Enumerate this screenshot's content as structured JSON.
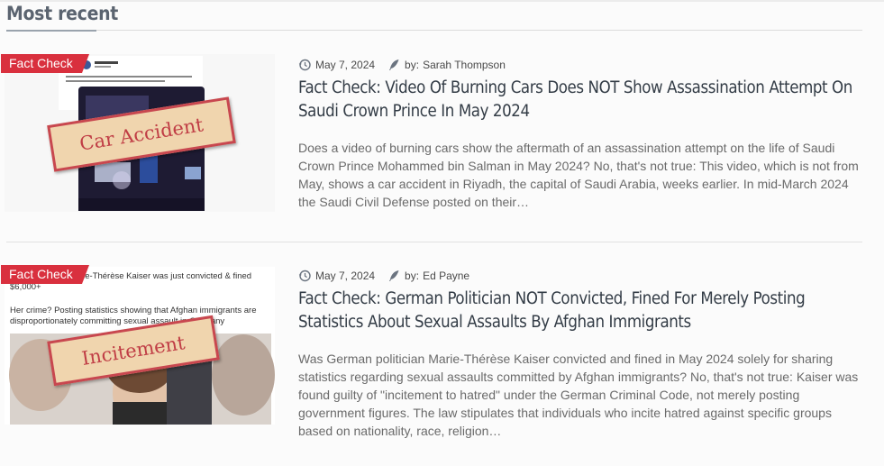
{
  "section": {
    "title": "Most recent"
  },
  "articles": [
    {
      "badge": "Fact Check",
      "stamp": "Car Accident",
      "date": "May 7, 2024",
      "author_prefix": "by:",
      "author": "Sarah Thompson",
      "headline": "Fact Check: Video Of Burning Cars Does NOT Show Assassination Attempt On Saudi Crown Prince In May 2024",
      "excerpt": "Does a video of burning cars show the aftermath of an assassination attempt on the life of Saudi Crown Prince Mohammed bin Salman in May 2024? No, that's not true: This video, which is not from May, shows a car accident in Riyadh, the capital of Saudi Arabia, weeks earlier. In mid-March 2024 the Saudi Civil Defense posted on their…",
      "thumb_text_1": "Saudi sources are reporting an assassination attempt against Saudi Crown Prince Mohammed bin Salman",
      "thumb_caption": "Riyadh, KSA · Riyadh"
    },
    {
      "badge": "Fact Check",
      "stamp": "Incitement",
      "date": "May 7, 2024",
      "author_prefix": "by:",
      "author": "Ed Payne",
      "headline": "Fact Check: German Politician NOT Convicted, Fined For Merely Posting Statistics About Sexual Assaults By Afghan Immigrants",
      "excerpt": "Was German politician Marie-Thérèse Kaiser convicted and fined in May 2024 solely for sharing statistics regarding sexual assaults committed by Afghan immigrants? No, that's not true: Kaiser was found guilty of \"incitement to hatred\" under the German Criminal Code, not merely posting government figures. The law stipulates that individuals who incite hatred against specific groups based on nationality, race, religion…",
      "thumb_text_1": "f the AfD party, Marie-Thérèse Kaiser was just convicted & fined $6,000+",
      "thumb_text_2": "Her crime? Posting statistics showing that Afghan immigrants are disproportionately committing sexual assault in Germany"
    }
  ],
  "colors": {
    "badge": "#d9303e",
    "stamp_border": "#c8474f",
    "stamp_bg": "#f0d5ae",
    "headline": "#333c46"
  }
}
